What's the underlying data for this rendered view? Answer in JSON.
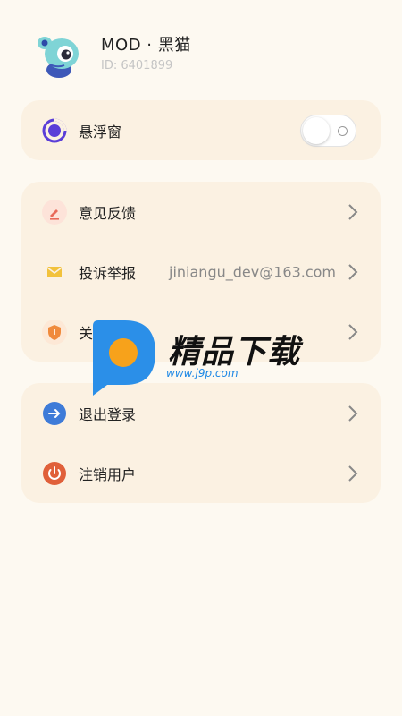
{
  "profile": {
    "name": "MOD · 黑猫",
    "user_id": "ID: 6401899",
    "avatar_icon": "chameleon-mascot-icon"
  },
  "floating_window": {
    "label": "悬浮窗",
    "icon": "floating-window-icon",
    "enabled": false
  },
  "support_menu": [
    {
      "label": "意见反馈",
      "icon": "feedback-pencil-icon",
      "value": ""
    },
    {
      "label": "投诉举报",
      "icon": "mail-icon",
      "value": "jiniangu_dev@163.com"
    },
    {
      "label": "关于我们",
      "icon": "shield-icon",
      "value": ""
    }
  ],
  "account_menu": [
    {
      "label": "退出登录",
      "icon": "logout-arrow-icon"
    },
    {
      "label": "注销用户",
      "icon": "power-icon"
    }
  ],
  "watermark": {
    "text": "精品下载",
    "url": "www.j9p.com"
  },
  "colors": {
    "background": "#fdf9f1",
    "card": "#fbf1e2",
    "accent_blue": "#3e7bd8",
    "danger": "#e0603a",
    "mail_yellow": "#f2c23c",
    "shield_orange": "#f08a3c",
    "feedback_red": "#e86a5a",
    "float_purple": "#5a3ed8"
  }
}
